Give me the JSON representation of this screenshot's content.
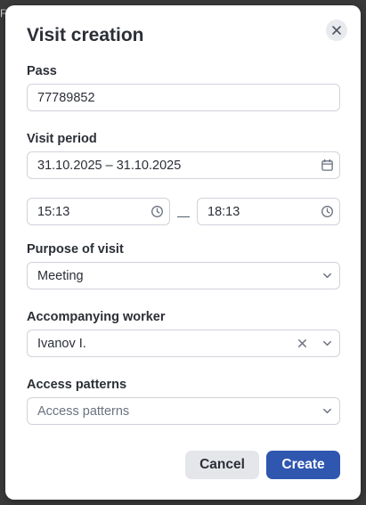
{
  "backdrop": {
    "edge_text": "F"
  },
  "dialog": {
    "title": "Visit creation",
    "close_icon": "close-icon",
    "pass": {
      "label": "Pass",
      "value": "77789852"
    },
    "visit_period": {
      "label": "Visit period",
      "date_range": "31.10.2025 – 31.10.2025",
      "date_icon": "calendar-icon",
      "time_start": "15:13",
      "time_separator": "—",
      "time_end": "18:13",
      "time_icon": "clock-icon"
    },
    "purpose": {
      "label": "Purpose of visit",
      "value": "Meeting",
      "dropdown_icon": "chevron-down-icon"
    },
    "worker": {
      "label": "Accompanying worker",
      "value": "Ivanov I.",
      "clear_icon": "clear-icon",
      "dropdown_icon": "chevron-down-icon"
    },
    "access_patterns": {
      "label": "Access patterns",
      "placeholder": "Access patterns",
      "dropdown_icon": "chevron-down-icon"
    },
    "buttons": {
      "cancel": "Cancel",
      "create": "Create"
    }
  },
  "colors": {
    "primary_button": "#2f57b0",
    "secondary_button": "#e4e6ea",
    "field_border": "#cfd3da",
    "overlay": "#3a3a3a"
  }
}
